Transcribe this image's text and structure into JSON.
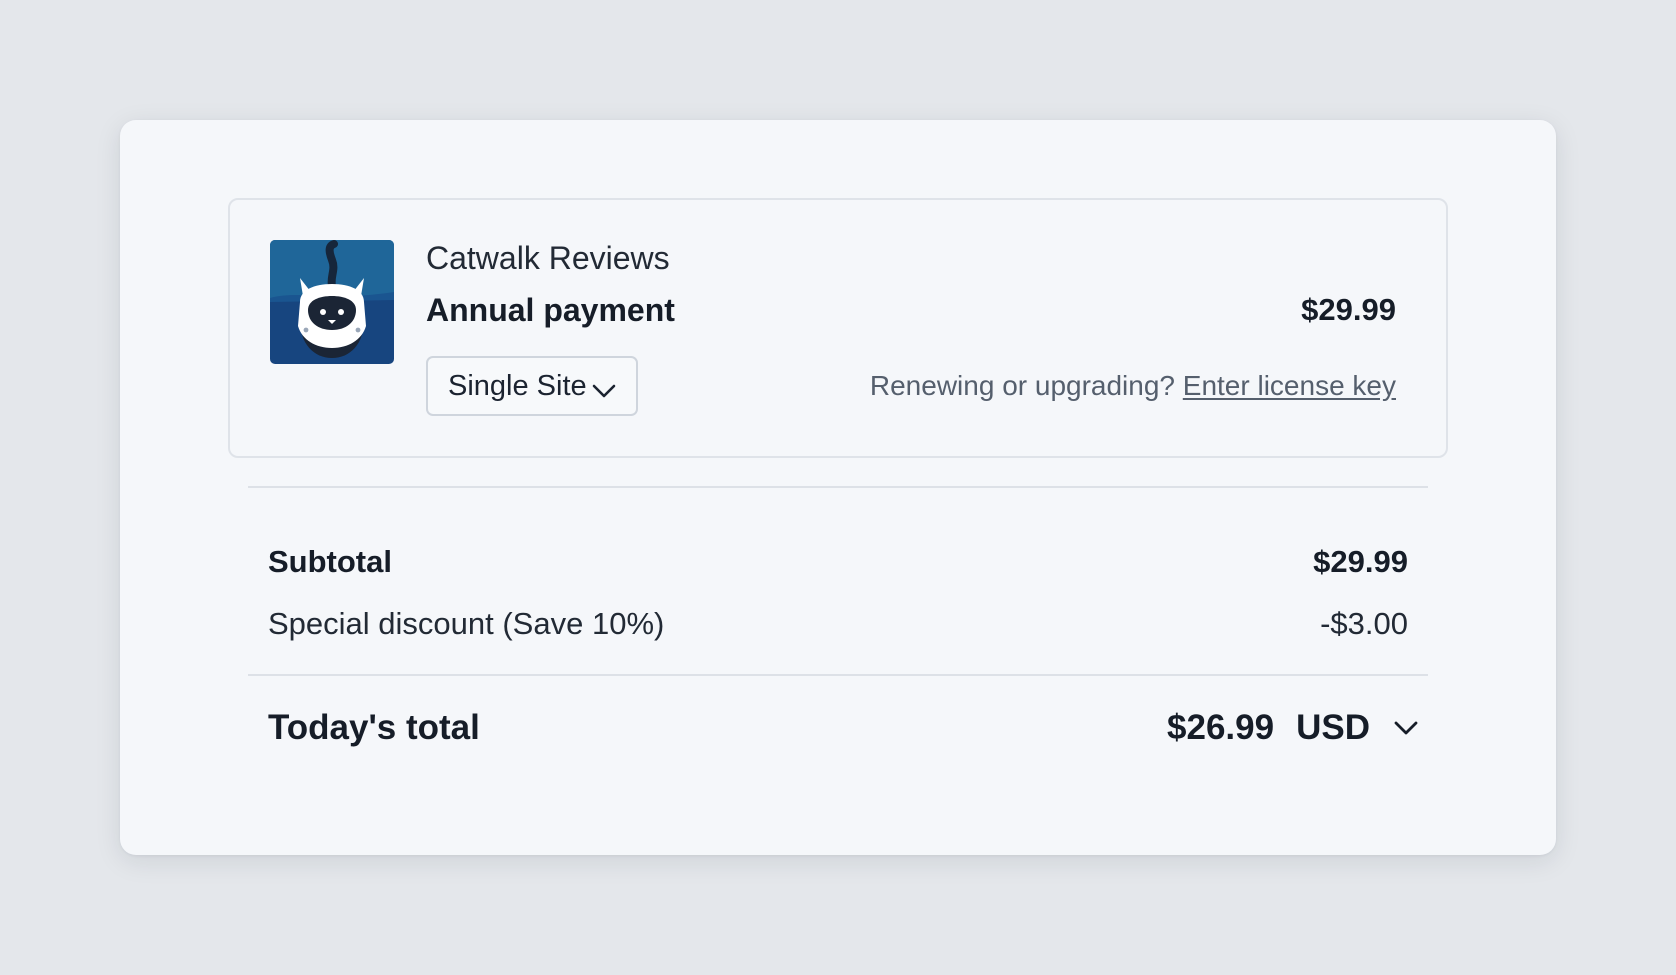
{
  "product": {
    "name": "Catwalk Reviews",
    "plan": "Annual payment",
    "price": "$29.99",
    "license_select": {
      "selected": "Single Site"
    },
    "renew_prompt": "Renewing or upgrading?",
    "renew_link": "Enter license key",
    "thumbnail_icon": "cat-logo-icon"
  },
  "summary": {
    "subtotal_label": "Subtotal",
    "subtotal_value": "$29.99",
    "discount_label": "Special discount (Save 10%)",
    "discount_value": "-$3.00",
    "total_label": "Today's total",
    "total_value": "$26.99",
    "currency": "USD"
  },
  "colors": {
    "page_bg": "#e4e7eb",
    "card_bg": "#f5f7fa",
    "text_primary": "#161d28",
    "text_muted": "#555f6d",
    "thumb_blue": "#1a4b86"
  }
}
